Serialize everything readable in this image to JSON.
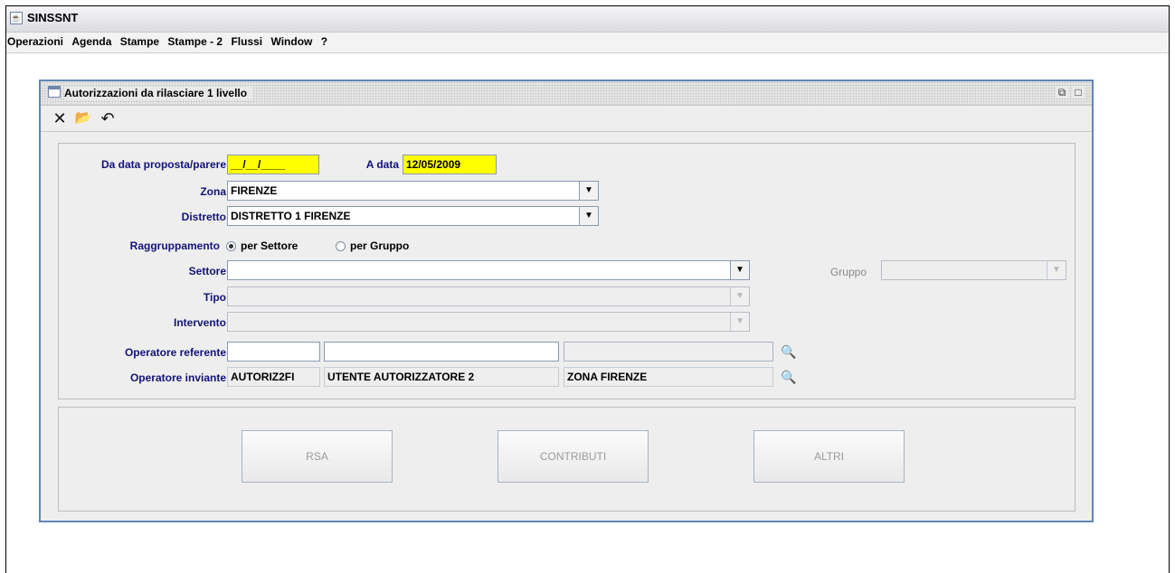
{
  "app": {
    "title": "SINSSNT"
  },
  "menu": [
    "Operazioni",
    "Agenda",
    "Stampe",
    "Stampe - 2",
    "Flussi",
    "Window",
    "?"
  ],
  "window": {
    "title": "Autorizzazioni da rilasciare 1 livello",
    "restore_glyph": "⧉",
    "maximize_glyph": "□"
  },
  "toolbar": {
    "close_glyph": "✕",
    "open_glyph": "📂",
    "undo_glyph": "↶"
  },
  "form": {
    "da_data_label": "Da data proposta/parere",
    "da_data_value": "__/__/____",
    "a_data_label": "A data",
    "a_data_value": "12/05/2009",
    "zona_label": "Zona",
    "zona_value": "FIRENZE",
    "distretto_label": "Distretto",
    "distretto_value": "DISTRETTO 1 FIRENZE",
    "raggruppamento_label": "Raggruppamento",
    "radio_settore": "per Settore",
    "radio_gruppo": "per Gruppo",
    "radio_selected": "per Settore",
    "settore_label": "Settore",
    "settore_value": "",
    "gruppo_label": "Gruppo",
    "gruppo_value": "",
    "tipo_label": "Tipo",
    "tipo_value": "",
    "intervento_label": "Intervento",
    "intervento_value": "",
    "op_referente_label": "Operatore referente",
    "op_referente_code": "",
    "op_referente_name": "",
    "op_referente_zone": "",
    "op_inviante_label": "Operatore inviante",
    "op_inviante_code": "AUTORIZ2FI",
    "op_inviante_name": "UTENTE AUTORIZZATORE 2",
    "op_inviante_zone": "ZONA FIRENZE"
  },
  "buttons": {
    "rsa": "RSA",
    "contributi": "CONTRIBUTI",
    "altri": "ALTRI"
  },
  "colors": {
    "accent": "#5f86b8",
    "label": "#13137a",
    "highlight": "#ffff00"
  },
  "icons": {
    "app": "java-icon",
    "search": "binoculars-icon",
    "dropdown": "chevron-down-icon"
  }
}
